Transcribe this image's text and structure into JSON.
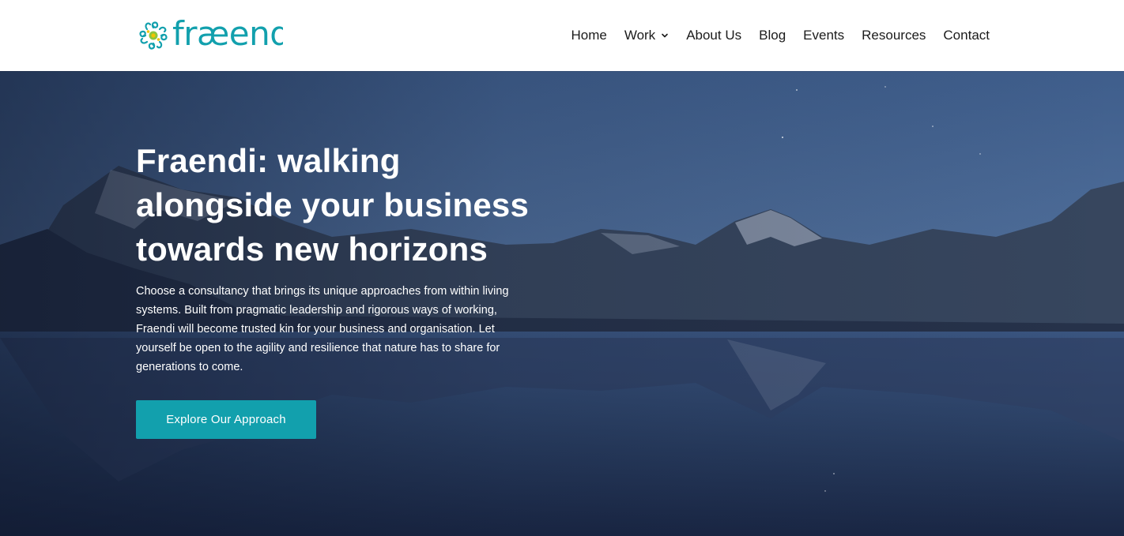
{
  "brand": {
    "name": "fraendi",
    "wordmark": "fræendi",
    "logo_icon": "spiral-flower-icon",
    "colors": {
      "teal": "#12a0ad",
      "green": "#8dc63f",
      "yellow": "#f2c300"
    }
  },
  "nav": {
    "items": [
      {
        "label": "Home"
      },
      {
        "label": "Work",
        "has_dropdown": true,
        "icon": "chevron-down-icon"
      },
      {
        "label": "About Us"
      },
      {
        "label": "Blog"
      },
      {
        "label": "Events"
      },
      {
        "label": "Resources"
      },
      {
        "label": "Contact"
      }
    ]
  },
  "hero": {
    "title": "Fraendi: walking alongside your business towards new horizons",
    "body": "Choose a consultancy that brings its unique approaches from within living systems. Built from pragmatic leadership and rigorous ways of working, Fraendi will become trusted kin for your business and organisation. Let yourself be open to the agility and resilience that nature has to share for generations to come.",
    "cta_label": "Explore Our Approach",
    "background": "night-mountain-lake-image"
  }
}
